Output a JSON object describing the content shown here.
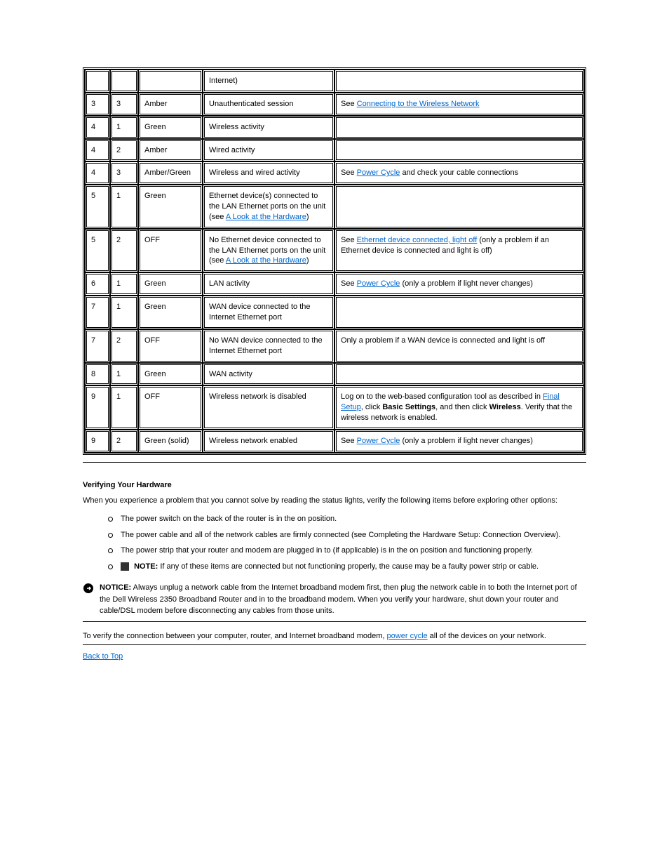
{
  "table": {
    "rows": [
      {
        "c0": "",
        "c1": "",
        "c2": "",
        "c3": "Internet)",
        "c4_pre": "",
        "c4_link": "",
        "c4_post": ""
      },
      {
        "c0": "3",
        "c1": "3",
        "c2": "Amber",
        "c3": "Unauthenticated session",
        "c4_pre": "See ",
        "c4_link": "Connecting to the Wireless Network",
        "c4_post": ""
      },
      {
        "c0": "4",
        "c1": "1",
        "c2": "Green",
        "c3": "Wireless activity",
        "c4_pre": "",
        "c4_link": "",
        "c4_post": ""
      },
      {
        "c0": "4",
        "c1": "2",
        "c2": "Amber",
        "c3": "Wired activity",
        "c4_pre": "",
        "c4_link": "",
        "c4_post": ""
      },
      {
        "c0": "4",
        "c1": "3",
        "c2": "Amber/Green",
        "c3": "Wireless and wired activity",
        "c4_pre": "See ",
        "c4_link": "Power Cycle",
        "c4_post": " and check your cable connections"
      },
      {
        "c0": "5",
        "c1": "1",
        "c2": "Green",
        "c3": "Ethernet device(s) connected to the LAN Ethernet ports on the unit (see ",
        "c3_link": "A Look at the Hardware",
        "c3_post": ")",
        "c4_pre": ""
      },
      {
        "c0": "5",
        "c1": "2",
        "c2": "OFF",
        "c3": "No Ethernet device connected to the LAN Ethernet ports on the unit (see ",
        "c3_link": "A Look at the Hardware",
        "c3_post": ")",
        "c4_pre": "See ",
        "c4_link": "Ethernet device connected, light off",
        "c4_post": " (only a problem if an Ethernet device is connected and light is off)"
      },
      {
        "c0": "6",
        "c1": "1",
        "c2": "Green",
        "c3": "LAN activity",
        "c4_pre": "See ",
        "c4_link": "Power Cycle",
        "c4_post": " (only a problem if light never changes)"
      },
      {
        "c0": "7",
        "c1": "1",
        "c2": "Green",
        "c3": "WAN device connected to the Internet Ethernet port",
        "c4_pre": "",
        "c4_link": "",
        "c4_post": ""
      },
      {
        "c0": "7",
        "c1": "2",
        "c2": "OFF",
        "c3": "No WAN device connected to the Internet Ethernet port",
        "c4_pre": "Only a problem if a WAN device is connected and light is off",
        "c4_link": "",
        "c4_post": ""
      },
      {
        "c0": "8",
        "c1": "1",
        "c2": "Green",
        "c3": "WAN activity",
        "c4_pre": "",
        "c4_link": "",
        "c4_post": ""
      },
      {
        "c0": "9",
        "c1": "1",
        "c2": "OFF",
        "c3": "Wireless network is disabled",
        "c4_pre": "Log on to the web-based configuration tool as described in ",
        "c4_link": "Final Setup",
        "c4_post": ", click ",
        "c4_bold": "Basic Settings",
        "c4_after_bold": ", and then click ",
        "c4_bold2": "Wireless",
        "c4_tail": ". Verify that the wireless network is enabled."
      },
      {
        "c0": "9",
        "c1": "2",
        "c2": "Green (solid)",
        "c3": "Wireless network enabled",
        "c4_pre": "See ",
        "c4_link": "Power Cycle",
        "c4_post": " (only a problem if light never changes)"
      }
    ]
  },
  "section_head": "Verifying Your Hardware",
  "intro": "When you experience a problem that you cannot solve by reading the status lights, verify the following items before exploring other options:",
  "notes": [
    {
      "text": "The power switch on the back of the router is in the on position."
    },
    {
      "text": "The power cable and all of the network cables are firmly connected (see ",
      "link": null,
      "tail": "Completing the Hardware Setup: Connection Overview",
      "after": ")."
    },
    {
      "text": "The power strip that your router and modem are plugged in to (if applicable) is in the on position and functioning properly."
    },
    {
      "text": "",
      "icon": true,
      "bold": "NOTE:",
      "rest": " If any of these items are connected but not functioning properly, the cause may be a faulty power strip or cable."
    }
  ],
  "notice_label": "NOTICE:",
  "notice_text": " Always unplug a network cable from the Internet broadband modem first, then plug the network cable in to both the Internet port of the Dell Wireless 2350 Broadband Router and in to the broadband modem. When you verify your hardware, shut down your router and cable/DSL modem before disconnecting any cables from those units.",
  "below_text_pre": "To verify the connection between your computer, router, and Internet broadband modem, ",
  "below_link": "power cycle",
  "below_text_post": " all of the devices on your network.",
  "footer_link": "Back to Top"
}
